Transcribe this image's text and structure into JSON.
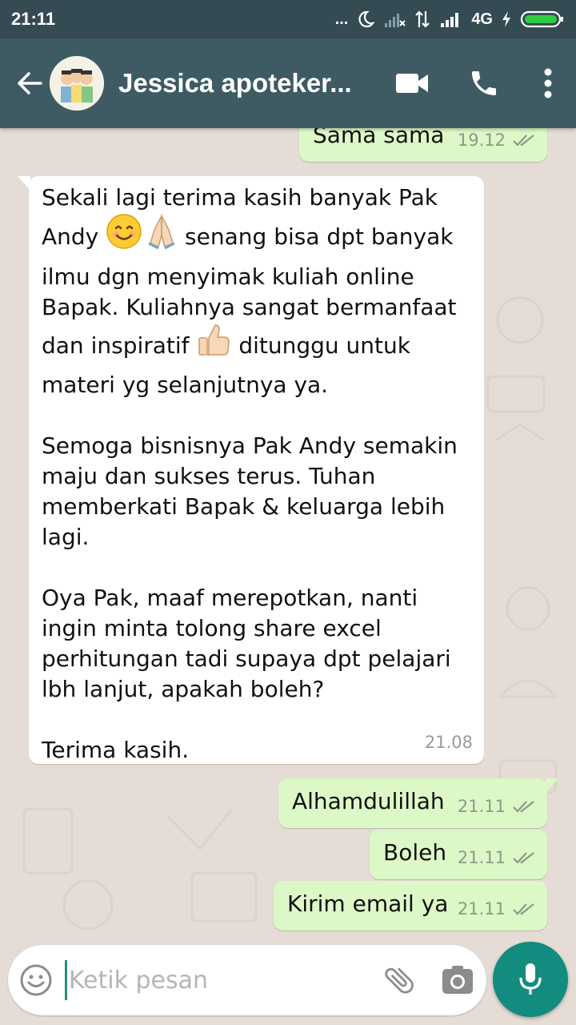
{
  "status_bar": {
    "time": "21:11",
    "more": "...",
    "network": "4G"
  },
  "header": {
    "contact_name": "Jessica apoteker...",
    "icons": [
      "back-arrow-icon",
      "avatar",
      "video-call-icon",
      "phone-icon",
      "more-vert-icon"
    ]
  },
  "messages": [
    {
      "direction": "out",
      "text": "Sama sama",
      "time": "19.12",
      "status": "read"
    },
    {
      "direction": "in",
      "paragraphs": [
        {
          "line1": "Sekali lagi terima kasih banyak Pak",
          "line2a": "Andy ",
          "emoji_a": "smiling-face-icon",
          "emoji_b": "folded-hands-icon",
          "line2b": " senang bisa dpt banyak",
          "line3": "ilmu dgn menyimak kuliah online",
          "line4": "Bapak. Kuliahnya sangat bermanfaat",
          "line5a": "dan inspiratif ",
          "emoji_c": "thumbs-up-icon",
          "line5b": " ditunggu untuk",
          "line6": "materi yg selanjutnya ya."
        },
        {
          "text": "Semoga bisnisnya Pak Andy semakin\nmaju dan sukses terus. Tuhan\nmemberkati Bapak & keluarga lebih\nlagi."
        },
        {
          "text": "Oya Pak, maaf merepotkan, nanti\ningin minta tolong share excel\nperhitungan tadi supaya dpt pelajari\nlbh lanjut, apakah boleh?"
        },
        {
          "text": "Terima kasih."
        }
      ],
      "time": "21.08"
    },
    {
      "direction": "out",
      "text": "Alhamdulillah",
      "time": "21.11",
      "status": "read"
    },
    {
      "direction": "out",
      "text": "Boleh",
      "time": "21.11",
      "status": "read"
    },
    {
      "direction": "out",
      "text": "Kirim email ya",
      "time": "21.11",
      "status": "read"
    }
  ],
  "composer": {
    "placeholder": "Ketik pesan",
    "icons": [
      "emoji-icon",
      "attach-icon",
      "camera-icon",
      "mic-icon"
    ]
  },
  "colors": {
    "app_bar": "#3e5b63",
    "status_bar": "#344b53",
    "chat_bg": "#e5ddd5",
    "bubble_out": "#dcf8c6",
    "bubble_in": "#ffffff",
    "read_ticks": "#8a9a8a",
    "mic_button": "#128c7e"
  }
}
